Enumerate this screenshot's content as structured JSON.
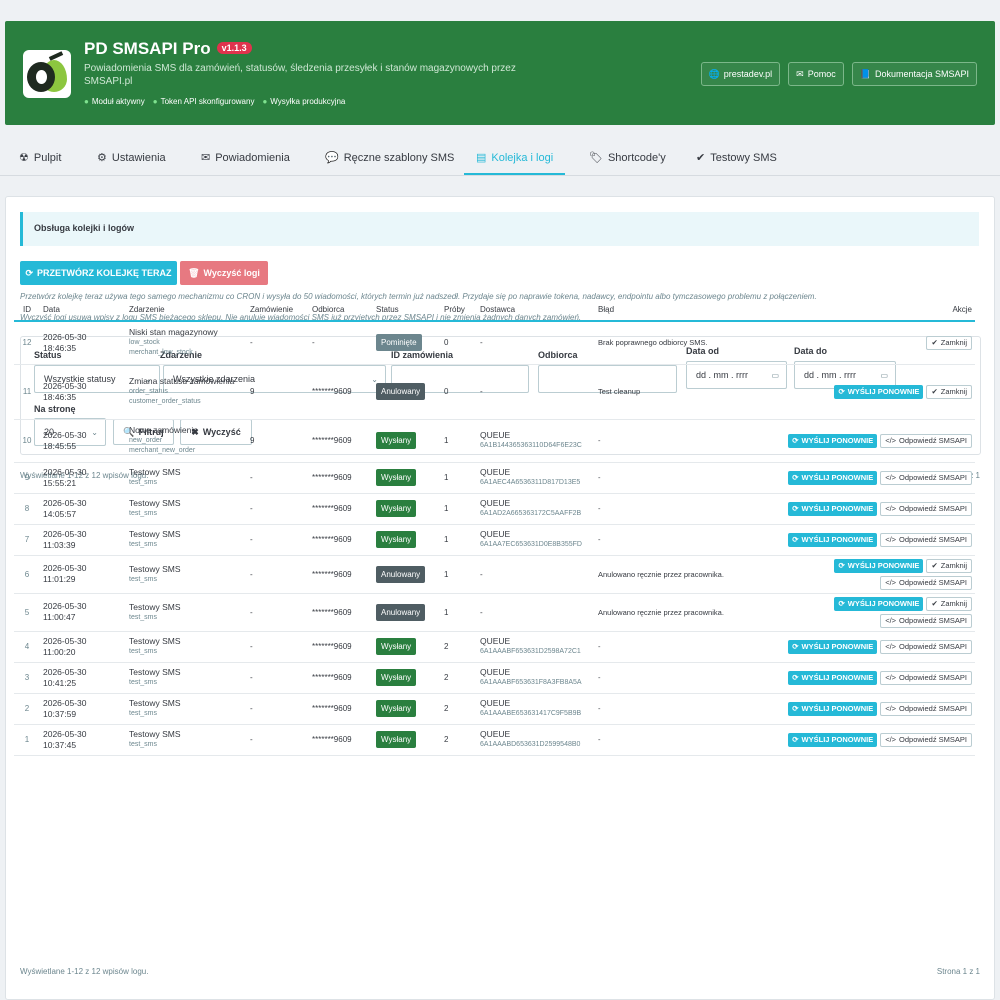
{
  "banner": {
    "title": "PD SMSAPI Pro",
    "version": "v1.1.3",
    "subtitle": "Powiadomienia SMS dla zamówień, statusów, śledzenia przesyłek i stanów magazynowych przez SMSAPI.pl",
    "status": [
      "Moduł aktywny",
      "Token API skonfigurowany",
      "Wysyłka produkcyjna"
    ],
    "links": [
      {
        "label": "prestadev.pl",
        "icon": "globe-icon"
      },
      {
        "label": "Pomoc",
        "icon": "envelope-icon"
      },
      {
        "label": "Dokumentacja SMSAPI",
        "icon": "book-icon"
      }
    ]
  },
  "tabs": [
    {
      "label": "Pulpit",
      "icon": "dashboard-icon",
      "glyph": "☢"
    },
    {
      "label": "Ustawienia",
      "icon": "gears-icon",
      "glyph": "⚙"
    },
    {
      "label": "Powiadomienia",
      "icon": "envelope-icon",
      "glyph": "✉"
    },
    {
      "label": "Ręczne szablony SMS",
      "icon": "comments-icon",
      "glyph": "💬"
    },
    {
      "label": "Kolejka i logi",
      "icon": "table-icon",
      "glyph": "▤"
    },
    {
      "label": "Shortcode'y",
      "icon": "tags-icon",
      "glyph": "🏷"
    },
    {
      "label": "Testowy SMS",
      "icon": "check-icon",
      "glyph": "✔"
    }
  ],
  "active_tab": "Kolejka i logi",
  "section_title": "Obsługa kolejki i logów",
  "actions": {
    "process_label": "PRZETWÓRZ KOLEJKĘ TERAZ",
    "clear_label": "Wyczyść logi"
  },
  "hints": [
    "Przetwórz kolejkę teraz używa tego samego mechanizmu co CRON i wysyła do 50 wiadomości, których termin już nadszedł. Przydaje się po naprawie tokena, nadawcy, endpointu albo tymczasowego problemu z połączeniem.",
    "Wyczyść logi usuwa wpisy z logu SMS bieżącego sklepu. Nie anuluje wiadomości SMS już przyjętych przez SMSAPI i nie zmienia żadnych danych zamówień."
  ],
  "filters": {
    "status_label": "Status",
    "status_value": "Wszystkie statusy",
    "event_label": "Zdarzenie",
    "event_value": "Wszystkie zdarzenia",
    "order_label": "ID zamówienia",
    "recipient_label": "Odbiorca",
    "date_from_label": "Data od",
    "date_to_label": "Data do",
    "date_placeholder": "dd . mm . rrrr",
    "per_page_label": "Na stronę",
    "per_page_value": "20",
    "filter_button": "Filtruj",
    "clear_button": "Wyczyść"
  },
  "summary": "Wyświetlane 1-12 z 12 wpisów logu.",
  "page_info": "Strona 1 z 1",
  "table": {
    "headers": [
      "ID",
      "Data",
      "Zdarzenie",
      "Zamówienie",
      "Odbiorca",
      "Status",
      "Próby",
      "Dostawca",
      "Błąd",
      "Akcje"
    ],
    "rows": [
      {
        "id": "12",
        "date": "2026-05-30",
        "time": "18:46:35",
        "event": "Niski stan magazynowy",
        "codes": [
          "low_stock",
          "merchant_low_stock"
        ],
        "order": "-",
        "recipient": "-",
        "status": "Pominięte",
        "status_type": "skip",
        "tries": "0",
        "provider": "-",
        "provider_id": "",
        "error": "Brak poprawnego odbiorcy SMS.",
        "actions": [
          "close"
        ]
      },
      {
        "id": "11",
        "date": "2026-05-30",
        "time": "18:46:35",
        "event": "Zmiana statusu zamówienia",
        "codes": [
          "order_status",
          "customer_order_status"
        ],
        "order": "9",
        "recipient": "*******9609",
        "status": "Anulowany",
        "status_type": "cancel",
        "tries": "0",
        "provider": "-",
        "provider_id": "",
        "error": "Test cleanup",
        "actions": [
          "retry",
          "close"
        ]
      },
      {
        "id": "10",
        "date": "2026-05-30",
        "time": "18:45:55",
        "event": "Nowe zamówienie",
        "codes": [
          "new_order",
          "merchant_new_order"
        ],
        "order": "9",
        "recipient": "*******9609",
        "status": "Wysłany",
        "status_type": "sent",
        "tries": "1",
        "provider": "QUEUE",
        "provider_id": "6A1B144365363110D64F6E23C",
        "error": "-",
        "actions": [
          "retry",
          "response"
        ]
      },
      {
        "id": "9",
        "date": "2026-05-30",
        "time": "15:55:21",
        "event": "Testowy SMS",
        "codes": [
          "test_sms"
        ],
        "order": "-",
        "recipient": "*******9609",
        "status": "Wysłany",
        "status_type": "sent",
        "tries": "1",
        "provider": "QUEUE",
        "provider_id": "6A1AEC4A6536311D817D13E5",
        "error": "-",
        "actions": [
          "retry",
          "response"
        ]
      },
      {
        "id": "8",
        "date": "2026-05-30",
        "time": "14:05:57",
        "event": "Testowy SMS",
        "codes": [
          "test_sms"
        ],
        "order": "-",
        "recipient": "*******9609",
        "status": "Wysłany",
        "status_type": "sent",
        "tries": "1",
        "provider": "QUEUE",
        "provider_id": "6A1AD2A665363172C5AAFF2B",
        "error": "-",
        "actions": [
          "retry",
          "response"
        ]
      },
      {
        "id": "7",
        "date": "2026-05-30",
        "time": "11:03:39",
        "event": "Testowy SMS",
        "codes": [
          "test_sms"
        ],
        "order": "-",
        "recipient": "*******9609",
        "status": "Wysłany",
        "status_type": "sent",
        "tries": "1",
        "provider": "QUEUE",
        "provider_id": "6A1AA7EC653631D0E8B355FD",
        "error": "-",
        "actions": [
          "retry",
          "response"
        ]
      },
      {
        "id": "6",
        "date": "2026-05-30",
        "time": "11:01:29",
        "event": "Testowy SMS",
        "codes": [
          "test_sms"
        ],
        "order": "-",
        "recipient": "*******9609",
        "status": "Anulowany",
        "status_type": "cancel",
        "tries": "1",
        "provider": "-",
        "provider_id": "",
        "error": "Anulowano ręcznie przez pracownika.",
        "actions": [
          "retry",
          "close",
          "response"
        ]
      },
      {
        "id": "5",
        "date": "2026-05-30",
        "time": "11:00:47",
        "event": "Testowy SMS",
        "codes": [
          "test_sms"
        ],
        "order": "-",
        "recipient": "*******9609",
        "status": "Anulowany",
        "status_type": "cancel",
        "tries": "1",
        "provider": "-",
        "provider_id": "",
        "error": "Anulowano ręcznie przez pracownika.",
        "actions": [
          "retry",
          "close",
          "response"
        ]
      },
      {
        "id": "4",
        "date": "2026-05-30",
        "time": "11:00:20",
        "event": "Testowy SMS",
        "codes": [
          "test_sms"
        ],
        "order": "-",
        "recipient": "*******9609",
        "status": "Wysłany",
        "status_type": "sent",
        "tries": "2",
        "provider": "QUEUE",
        "provider_id": "6A1AAABF653631D2598A72C1",
        "error": "-",
        "actions": [
          "retry",
          "response"
        ]
      },
      {
        "id": "3",
        "date": "2026-05-30",
        "time": "10:41:25",
        "event": "Testowy SMS",
        "codes": [
          "test_sms"
        ],
        "order": "-",
        "recipient": "*******9609",
        "status": "Wysłany",
        "status_type": "sent",
        "tries": "2",
        "provider": "QUEUE",
        "provider_id": "6A1AAABF653631F8A3FB8A5A",
        "error": "-",
        "actions": [
          "retry",
          "response"
        ]
      },
      {
        "id": "2",
        "date": "2026-05-30",
        "time": "10:37:59",
        "event": "Testowy SMS",
        "codes": [
          "test_sms"
        ],
        "order": "-",
        "recipient": "*******9609",
        "status": "Wysłany",
        "status_type": "sent",
        "tries": "2",
        "provider": "QUEUE",
        "provider_id": "6A1AAABE653631417C9F5B9B",
        "error": "-",
        "actions": [
          "retry",
          "response"
        ]
      },
      {
        "id": "1",
        "date": "2026-05-30",
        "time": "10:37:45",
        "event": "Testowy SMS",
        "codes": [
          "test_sms"
        ],
        "order": "-",
        "recipient": "*******9609",
        "status": "Wysłany",
        "status_type": "sent",
        "tries": "2",
        "provider": "QUEUE",
        "provider_id": "6A1AAABD653631D2599548B0",
        "error": "-",
        "actions": [
          "retry",
          "response"
        ]
      }
    ]
  },
  "action_labels": {
    "retry": "WYŚLIJ PONOWNIE",
    "close": "Zamknij",
    "response": "Odpowiedź SMSAPI"
  }
}
